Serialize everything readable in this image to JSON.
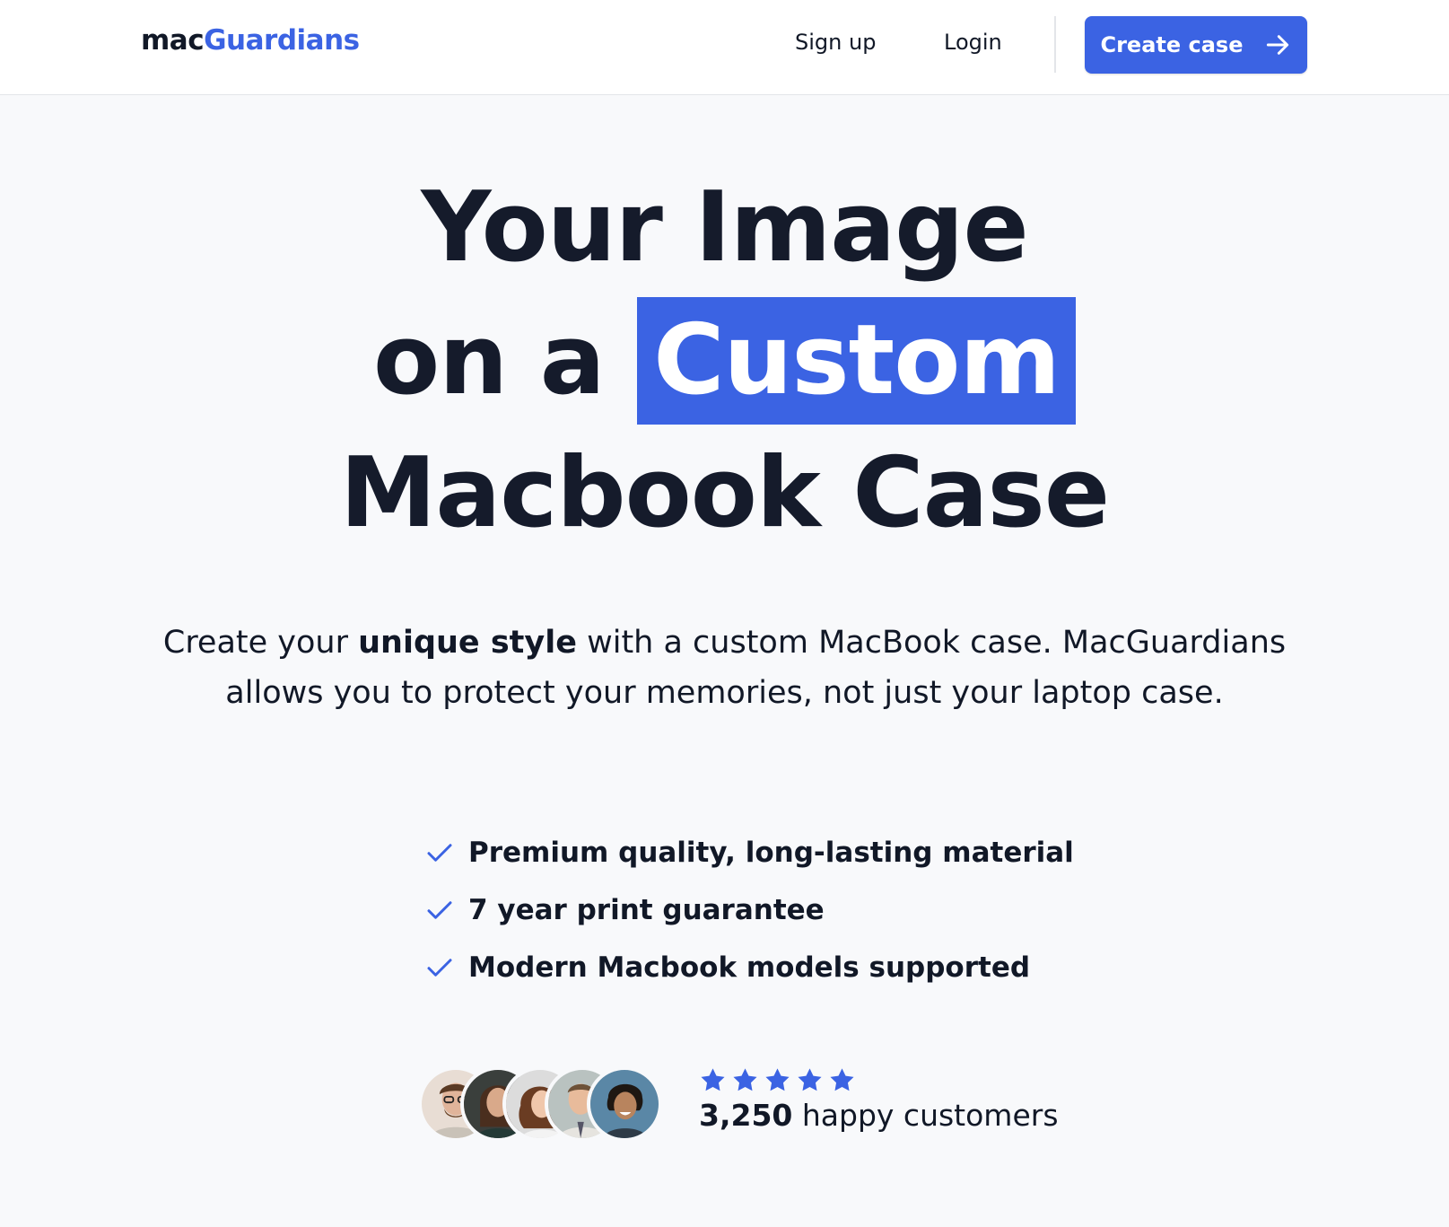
{
  "nav": {
    "logo_part1": "mac",
    "logo_part2": "Guardians",
    "signup": "Sign up",
    "login": "Login",
    "cta": "Create case"
  },
  "hero": {
    "line1": "Your Image",
    "line2_prefix": "on a ",
    "line2_highlight": "Custom",
    "line3": "Macbook Case"
  },
  "description": {
    "part1": "Create your ",
    "bold": "unique style",
    "part2": " with a custom MacBook case. MacGuardians allows you to protect your memories, not just your laptop case."
  },
  "features": [
    "Premium quality, long-lasting material",
    "7 year print guarantee",
    "Modern Macbook models supported"
  ],
  "social_proof": {
    "rating_stars": 5,
    "count": "3,250",
    "suffix": " happy customers"
  },
  "colors": {
    "accent": "#3b63e3",
    "text": "#111827",
    "background": "#f8f9fb"
  },
  "icons": {
    "cta": "arrow-right-icon",
    "feature": "check-icon",
    "rating": "star-icon"
  }
}
